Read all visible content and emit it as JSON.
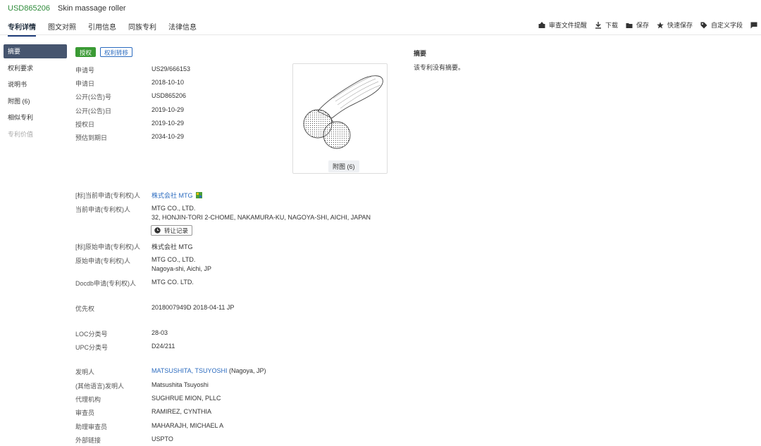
{
  "header": {
    "patent_no": "USD865206",
    "patent_name": "Skin massage roller",
    "tabs": [
      "专利详情",
      "图文对照",
      "引用信息",
      "同族专利",
      "法律信息"
    ],
    "actions": [
      {
        "label": "审查文件提醒",
        "icon": "bell-upload-icon"
      },
      {
        "label": "下载",
        "icon": "download-icon"
      },
      {
        "label": "保存",
        "icon": "folder-icon"
      },
      {
        "label": "快速保存",
        "icon": "star-icon"
      },
      {
        "label": "自定义字段",
        "icon": "tag-icon"
      }
    ]
  },
  "sidebar": {
    "items": [
      {
        "label": "摘要"
      },
      {
        "label": "权利要求"
      },
      {
        "label": "说明书"
      },
      {
        "label": "附图 (6)"
      },
      {
        "label": "相似专利"
      },
      {
        "label": "专利价值"
      }
    ]
  },
  "status": {
    "badge_granted": "授权",
    "badge_transfer": "权利转移"
  },
  "biblio": {
    "app_no_label": "申请号",
    "app_no": "US29/666153",
    "app_date_label": "申请日",
    "app_date": "2018-10-10",
    "pub_no_label": "公开(公告)号",
    "pub_no": "USD865206",
    "pub_date_label": "公开(公告)日",
    "pub_date": "2019-10-29",
    "grant_date_label": "授权日",
    "grant_date": "2019-10-29",
    "expiry_label": "预估到期日",
    "expiry": "2034-10-29"
  },
  "figure": {
    "button": "附图 (6)"
  },
  "abstract": {
    "title": "摘要",
    "text": "该专利没有摘要。"
  },
  "parties": {
    "std_current_label": "[标]当前申请(专利权)人",
    "std_current": "株式会社 MTG",
    "current_label": "当前申请(专利权)人",
    "current": "MTG CO., LTD.",
    "current_address": "32, HONJIN-TORI 2-CHOME, NAKAMURA-KU, NAGOYA-SHI, AICHI, JAPAN",
    "transfer_button": "转让记录",
    "std_original_label": "[标]原始申请(专利权)人",
    "std_original": "株式会社 MTG",
    "original_label": "原始申请(专利权)人",
    "original": "MTG CO., LTD.",
    "original_address": "Nagoya-shi, Aichi, JP",
    "docdb_label": "Docdb申请(专利权)人",
    "docdb": "MTG CO. LTD."
  },
  "priority": {
    "label": "优先权",
    "value": "2018007949D 2018-04-11 JP"
  },
  "classification": {
    "loc_label": "LOC分类号",
    "loc": "28-03",
    "upc_label": "UPC分类号",
    "upc": "D24/211"
  },
  "people": {
    "inventor_label": "发明人",
    "inventor": "MATSUSHITA, TSUYOSHI",
    "inventor_suffix": "(Nagoya, JP)",
    "inventor_other_label": "(其他语言)发明人",
    "inventor_other": "Matsushita Tsuyoshi",
    "agency_label": "代理机构",
    "agency": "SUGHRUE MION, PLLC",
    "examiner_label": "审查员",
    "examiner": "RAMIREZ, CYNTHIA",
    "asst_examiner_label": "助理审查员",
    "asst_examiner": "MAHARAJH, MICHAEL A",
    "external_label": "外部链接",
    "external": "USPTO"
  },
  "colors": {
    "accent_green": "#3a9a34",
    "link_blue": "#2b6bbf",
    "nav_active": "#46556f"
  }
}
